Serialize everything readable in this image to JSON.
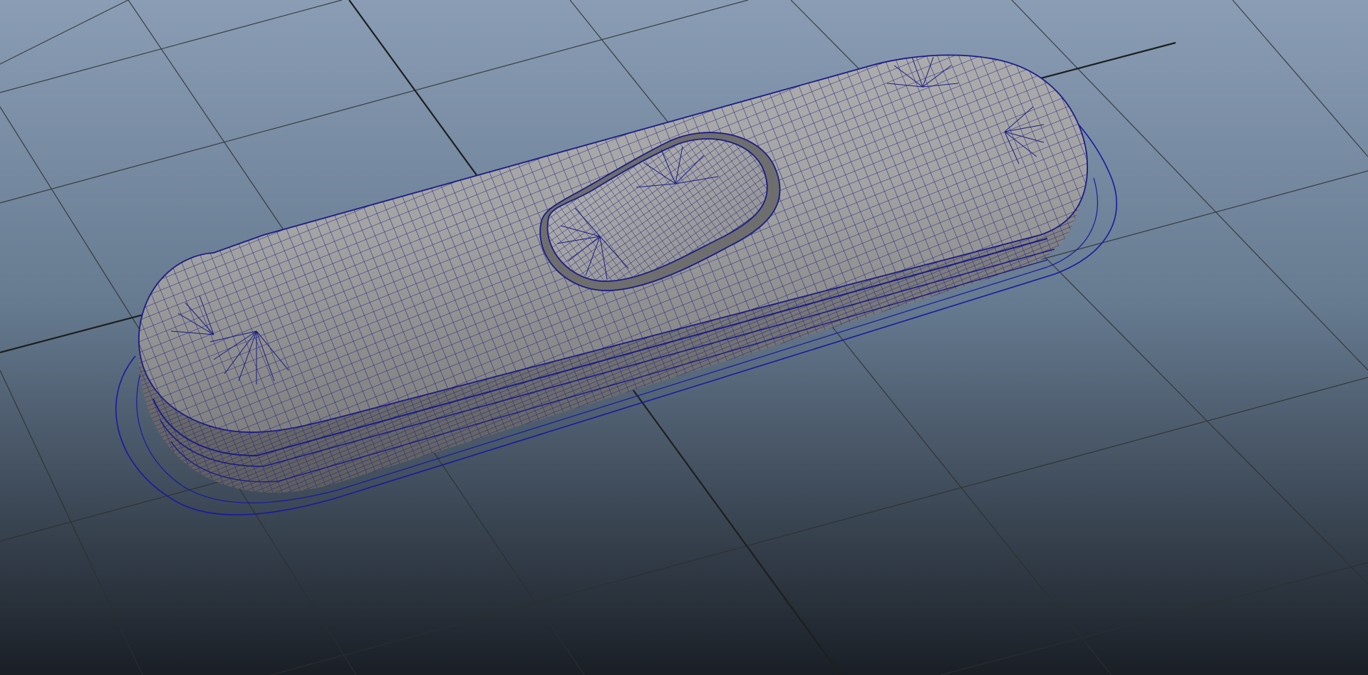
{
  "app": {
    "view": "3d-viewport",
    "display_mode": "smooth-shaded-with-wireframe"
  },
  "viewport": {
    "background_gradient": [
      "#8a9db5",
      "#1a1f26"
    ],
    "grid_color": "#2c2f30",
    "grid_center_line_color": "#1d1f1f"
  },
  "model": {
    "shape": "rounded-capsule-switch-housing",
    "feature": "raised-slider-button",
    "shading_color": "#a3a3a3",
    "wireframe_color": "#1c1c86",
    "cage_outline_color": "#1a1aa0"
  }
}
